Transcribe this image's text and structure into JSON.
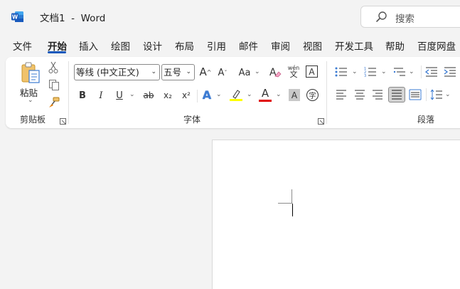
{
  "window": {
    "title": "文档1  -  Word"
  },
  "search": {
    "placeholder": "搜索"
  },
  "tabs": [
    "文件",
    "开始",
    "插入",
    "绘图",
    "设计",
    "布局",
    "引用",
    "邮件",
    "审阅",
    "视图",
    "开发工具",
    "帮助",
    "百度网盘"
  ],
  "active_tab": "开始",
  "ribbon": {
    "clipboard": {
      "paste_label": "粘贴",
      "group_label": "剪贴板"
    },
    "font": {
      "font_name": "等线 (中文正文)",
      "font_size": "五号",
      "group_label": "字体",
      "bold": "B",
      "italic": "I",
      "underline": "U",
      "strike": "ab",
      "subscript": "x₂",
      "superscript": "x²",
      "grow": "A",
      "shrink": "A",
      "case": "Aa",
      "phonetic": "wén",
      "border_char": "A",
      "text_effect": "A",
      "font_color": "A",
      "shade_char": "A",
      "enclose": "字"
    },
    "paragraph": {
      "group_label": "段落"
    }
  },
  "colors": {
    "accent": "#185abd",
    "highlight": "#ffff00",
    "font_color": "#e00000"
  }
}
